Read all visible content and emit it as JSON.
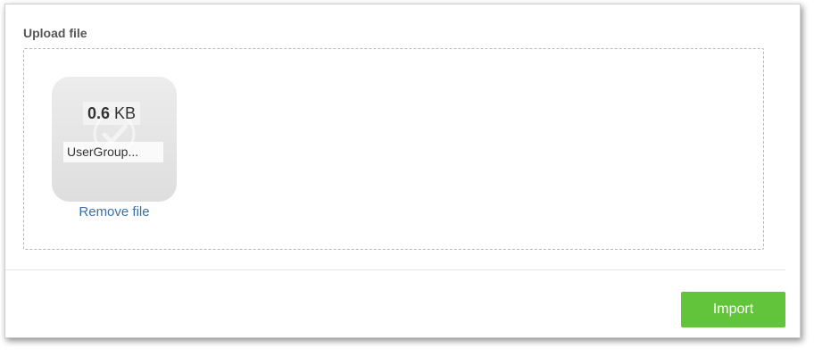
{
  "upload": {
    "section_title": "Upload file",
    "file": {
      "size_value": "0.6",
      "size_unit": "KB",
      "name": "UserGroup...",
      "remove_label": "Remove file",
      "status_icon": "check-icon"
    }
  },
  "footer": {
    "import_label": "Import"
  },
  "colors": {
    "accent_green": "#62c43a",
    "link_blue": "#3b6fa8",
    "title_gray": "#555555"
  }
}
